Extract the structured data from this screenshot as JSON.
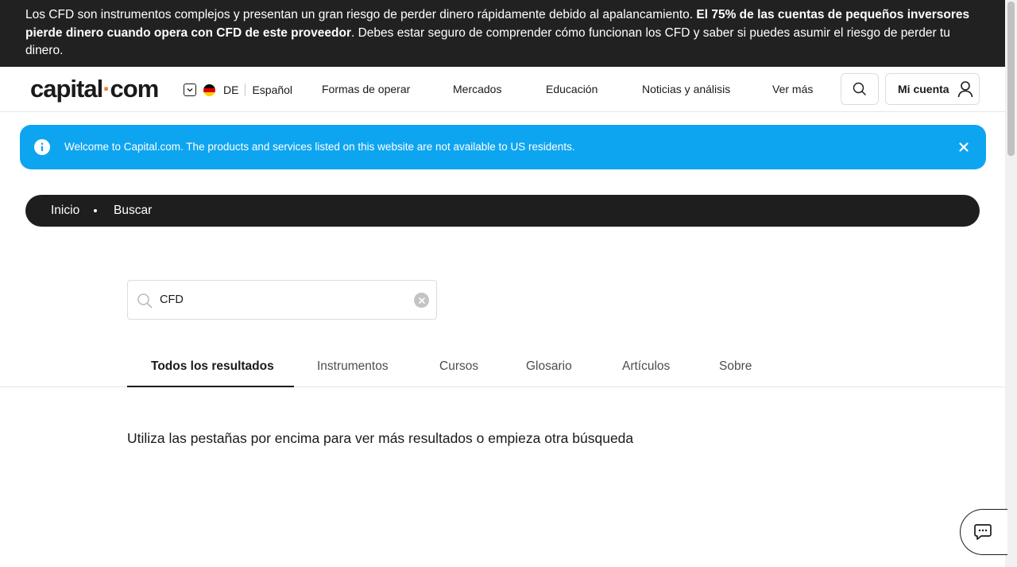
{
  "risk_banner": {
    "text_1": "Los CFD son instrumentos complejos y presentan un gran riesgo de perder dinero rápidamente debido al apalancamiento. ",
    "text_bold": "El 75% de las cuentas de pequeños inversores pierde dinero cuando opera con CFD de este proveedor",
    "text_2": ". Debes estar seguro de comprender cómo funcionan los CFD y saber si puedes asumir el riesgo de perder tu dinero."
  },
  "header": {
    "logo_part1": "capital",
    "logo_dot": "·",
    "logo_part2": "com",
    "country_code": "DE",
    "language": "Español",
    "nav": [
      "Formas de operar",
      "Mercados",
      "Educación",
      "Noticias y análisis",
      "Ver más"
    ],
    "account_label": "Mi cuenta"
  },
  "notice": {
    "text": "Welcome to Capital.com. The products and services listed on this website are not available to US residents."
  },
  "breadcrumb": {
    "home": "Inicio",
    "current": "Buscar"
  },
  "search": {
    "value": "CFD"
  },
  "tabs": [
    "Todos los resultados",
    "Instrumentos",
    "Cursos",
    "Glosario",
    "Artículos",
    "Sobre"
  ],
  "hint": "Utiliza las pestañas por encima para ver más resultados o empieza otra búsqueda",
  "colors": {
    "accent_blue": "#0ea5f0",
    "logo_dot": "#e5803c",
    "dark": "#212121"
  }
}
